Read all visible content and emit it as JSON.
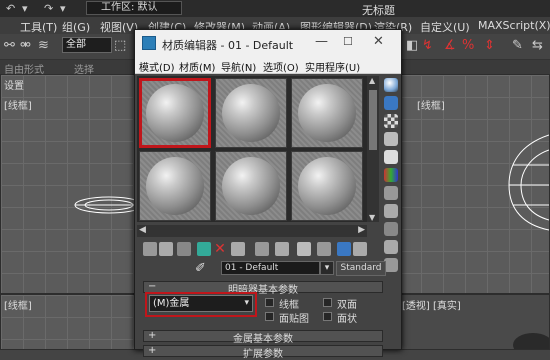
{
  "app": {
    "title": "无标题",
    "workspace": "工作区: 默认",
    "selection_filter": "全部",
    "menu": [
      "工具(T)",
      "组(G)",
      "视图(V)",
      "创建(C)",
      "修改器(M)",
      "动画(A)",
      "图形编辑器(D)",
      "渲染(R)",
      "自定义(U)",
      "MAXScript(X)"
    ],
    "ribbon": [
      "自由形式",
      "选择"
    ],
    "viewports": {
      "top_left_label": "[线框]",
      "top_right_label": "[线框]",
      "left_small_label": "设置",
      "bottom_left_label": "[线框]",
      "bottom_right_label": "[透视] [真实]"
    }
  },
  "material_editor": {
    "title": "材质编辑器 - 01 - Default",
    "menu": [
      "模式(D)",
      "材质(M)",
      "导航(N)",
      "选项(O)",
      "实用程序(U)"
    ],
    "material_name": "01 - Default",
    "material_type": "Standard",
    "rollouts": {
      "shader_basic": "明暗器基本参数",
      "metal_basic": "金属基本参数",
      "extended": "扩展参数"
    },
    "shader": "(M)金属",
    "options": {
      "wire": "线框",
      "two_sided": "双面",
      "face_map": "面贴图",
      "faceted": "面状"
    }
  },
  "colors": {
    "highlight": "#c0161b",
    "accent": "#2c7fb8"
  }
}
